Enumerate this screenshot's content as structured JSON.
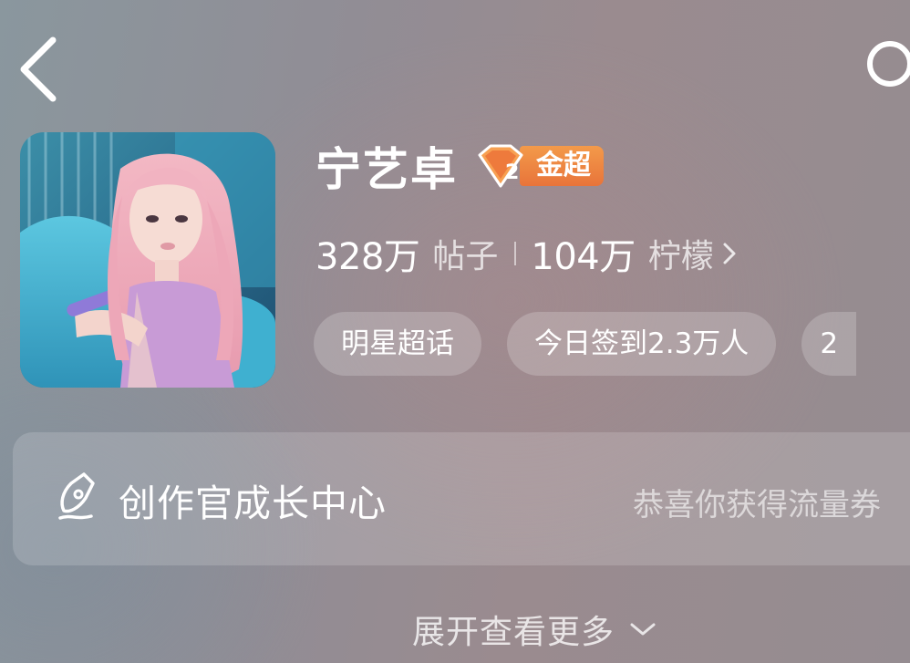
{
  "header": {
    "back_icon": "chevron-left-icon",
    "search_icon": "search-icon"
  },
  "profile": {
    "name": "宁艺卓",
    "badge": {
      "level": "2",
      "label": "金超",
      "color": "#ec7a3c"
    },
    "stats": {
      "posts_count": "328万",
      "posts_label": "帖子",
      "followers_count": "104万",
      "followers_label": "柠檬"
    },
    "tags": [
      {
        "label": "明星超话"
      },
      {
        "label": "今日签到2.3万人"
      },
      {
        "label": "2"
      }
    ]
  },
  "creator_card": {
    "icon": "pen-icon",
    "title": "创作官成长中心",
    "hint": "恭喜你获得流量券"
  },
  "expand": {
    "label": "展开查看更多",
    "icon": "chevron-down-icon"
  }
}
